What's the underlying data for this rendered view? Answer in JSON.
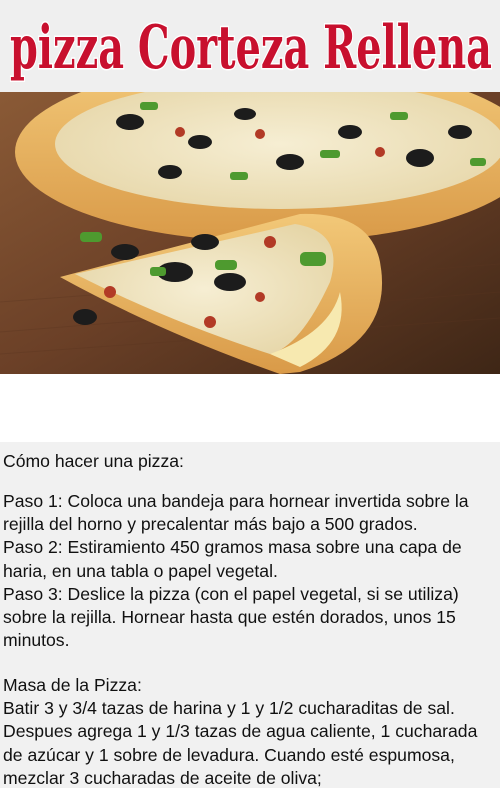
{
  "header": {
    "title": "pizza Corteza Rellena",
    "title_color": "#c8102e"
  },
  "photo": {
    "icon": "stuffed-crust-pizza-photo"
  },
  "content": {
    "intro": "Cómo hacer una pizza:",
    "steps": [
      " Paso 1: Coloca una bandeja para hornear invertida sobre la rejilla del horno y precalentar más bajo a 500 grados.",
      " Paso 2: Estiramiento 450 gramos masa sobre una capa de haria, en una tabla o papel vegetal.",
      " Paso 3: Deslice la pizza (con el papel vegetal, si se utiliza) sobre la rejilla. Hornear hasta que estén dorados, unos 15 minutos."
    ],
    "masa_title": " Masa de la Pizza:",
    "masa_text": " Batir 3 y 3/4 tazas de harina y 1 y 1/2 cucharaditas de sal. Despues agrega 1 y 1/3 tazas de agua caliente, 1 cucharada de azúcar y 1 sobre de levadura. Cuando esté espumosa, mezclar 3 cucharadas de aceite de oliva;"
  }
}
